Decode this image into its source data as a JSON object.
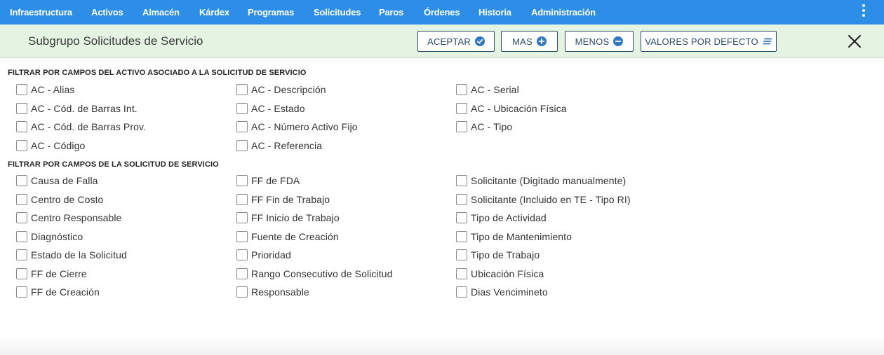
{
  "nav": {
    "items": [
      "Infraestructura",
      "Activos",
      "Almacén",
      "Kárdex",
      "Programas",
      "Solicitudes",
      "Paros",
      "Órdenes",
      "Historia",
      "Administración"
    ],
    "menu_icon": "more-vertical-icon"
  },
  "toolbar": {
    "title": "Subgrupo Solicitudes de Servicio",
    "accept_label": "ACEPTAR",
    "accept_icon": "check-circle-icon",
    "more_label": "MAS",
    "more_icon": "plus-circle-icon",
    "less_label": "MENOS",
    "less_icon": "minus-circle-icon",
    "defaults_label": "VALORES POR DEFECTO",
    "defaults_icon": "lines-icon",
    "close_icon": "close-icon"
  },
  "sections": [
    {
      "title": "FILTRAR POR CAMPOS DEL ACTIVO ASOCIADO A LA SOLICITUD DE SERVICIO",
      "columns": [
        [
          "AC - Alias",
          "AC - Cód. de Barras Int.",
          "AC - Cód. de Barras Prov.",
          "AC - Código"
        ],
        [
          "AC - Descripción",
          "AC - Estado",
          "AC - Número Activo Fijo",
          "AC - Referencia"
        ],
        [
          "AC - Serial",
          "AC - Ubicación Física",
          "AC - Tipo"
        ]
      ]
    },
    {
      "title": "FILTRAR POR CAMPOS DE LA SOLICITUD DE SERVICIO",
      "columns": [
        [
          "Causa de Falla",
          "Centro de Costo",
          "Centro Responsable",
          "Diagnóstico",
          "Estado de la Solicitud",
          "FF de Cierre",
          "FF de Creación"
        ],
        [
          "FF de FDA",
          "FF Fin de Trabajo",
          "FF Inicio de Trabajo",
          "Fuente de Creación",
          "Prioridad",
          "Rango Consecutivo de Solicitud",
          "Responsable"
        ],
        [
          "Solicitante (Digitado manualmente)",
          "Solicitante (Incluido en TE - Tipo RI)",
          "Tipo de Actividad",
          "Tipo de Mantenimiento",
          "Tipo de Trabajo",
          "Ubicación Física",
          "Dias Vencimineto"
        ]
      ]
    }
  ],
  "colors": {
    "nav_bg": "#2d8ee8",
    "toolbar_bg": "#e5f3e3",
    "button_border": "#2b4b63",
    "button_text": "#2a4d6e",
    "button_icon": "#2f79c4"
  }
}
